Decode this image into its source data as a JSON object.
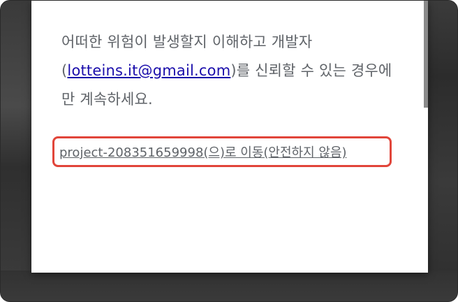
{
  "warning": {
    "before_email": "어떠한 위험이 발생할지 이해하고 개발자 (",
    "email": "lotteins.it@gmail.com",
    "after_email": ")를 신뢰할 수 있는 경우에만 계속하세요."
  },
  "unsafe_link": {
    "label": "project-208351659998(으)로 이동(안전하지 않음)"
  },
  "colors": {
    "link": "#1a0dab",
    "highlight_border": "#e1453a",
    "text": "#5f6368"
  }
}
